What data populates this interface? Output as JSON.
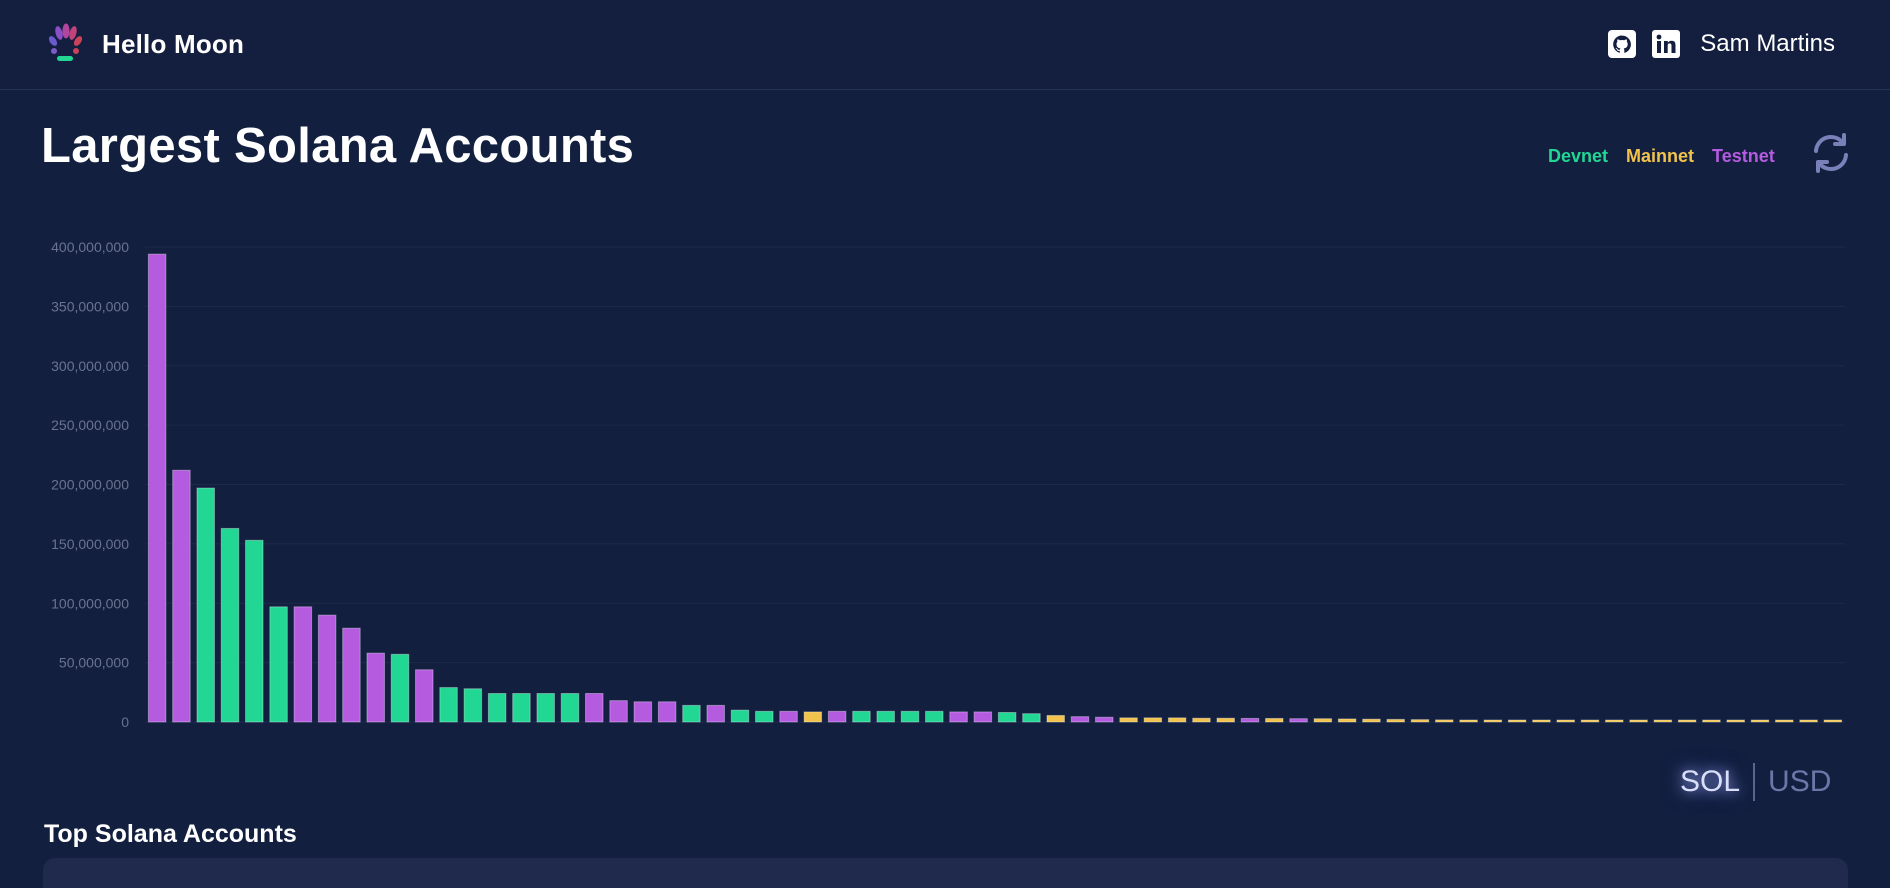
{
  "brand": {
    "name": "Hello Moon"
  },
  "nav": {
    "user": "Sam Martins",
    "icons": [
      "github-icon",
      "linkedin-icon"
    ]
  },
  "page": {
    "title": "Largest Solana Accounts"
  },
  "legend": [
    {
      "label": "Devnet",
      "color": "#22d694"
    },
    {
      "label": "Mainnet",
      "color": "#f2c34c"
    },
    {
      "label": "Testnet",
      "color": "#b55be0"
    }
  ],
  "toggle": {
    "sol": "SOL",
    "usd": "USD",
    "selected": "SOL"
  },
  "section": {
    "title": "Top Solana Accounts"
  },
  "colors": {
    "background": "#121f3f",
    "card": "#1f2a4c",
    "devnet": "#22d694",
    "mainnet": "#f2c34c",
    "testnet": "#b55be0"
  },
  "chart_data": {
    "type": "bar",
    "title": "",
    "xlabel": "",
    "ylabel": "",
    "ylim": [
      0,
      400000000
    ],
    "yticks": [
      0,
      50000000,
      100000000,
      150000000,
      200000000,
      250000000,
      300000000,
      350000000,
      400000000
    ],
    "ytick_labels": [
      "0",
      "50,000,000",
      "100,000,000",
      "150,000,000",
      "200,000,000",
      "250,000,000",
      "300,000,000",
      "350,000,000",
      "400,000,000"
    ],
    "grid": true,
    "legend": "top-right",
    "values": [
      394000000,
      212000000,
      197000000,
      163000000,
      153000000,
      97000000,
      97000000,
      90000000,
      79000000,
      58000000,
      57000000,
      44000000,
      29000000,
      28000000,
      24000000,
      24000000,
      24000000,
      24000000,
      24000000,
      18000000,
      17000000,
      17000000,
      14000000,
      14000000,
      10000000,
      9000000,
      9000000,
      8500000,
      9000000,
      9000000,
      9000000,
      9000000,
      9000000,
      8500000,
      8500000,
      8000000,
      7000000,
      5500000,
      4500000,
      4000000,
      3500000,
      3500000,
      3500000,
      3200000,
      3200000,
      3000000,
      3000000,
      2800000,
      2800000,
      2600000,
      2400000,
      2200000,
      2000000,
      1800000,
      1600000,
      1500000,
      1400000,
      1300000,
      1200000,
      1100000,
      1000000,
      900000,
      800000,
      700000,
      600000,
      500000,
      400000,
      300000,
      200000,
      100000
    ],
    "networks": [
      "Testnet",
      "Testnet",
      "Devnet",
      "Devnet",
      "Devnet",
      "Devnet",
      "Testnet",
      "Testnet",
      "Testnet",
      "Testnet",
      "Devnet",
      "Testnet",
      "Devnet",
      "Devnet",
      "Devnet",
      "Devnet",
      "Devnet",
      "Devnet",
      "Testnet",
      "Testnet",
      "Testnet",
      "Testnet",
      "Devnet",
      "Testnet",
      "Devnet",
      "Devnet",
      "Testnet",
      "Mainnet",
      "Testnet",
      "Devnet",
      "Devnet",
      "Devnet",
      "Devnet",
      "Testnet",
      "Testnet",
      "Devnet",
      "Devnet",
      "Mainnet",
      "Testnet",
      "Testnet",
      "Mainnet",
      "Mainnet",
      "Mainnet",
      "Mainnet",
      "Mainnet",
      "Testnet",
      "Mainnet",
      "Testnet",
      "Mainnet",
      "Mainnet",
      "Mainnet",
      "Mainnet",
      "Mainnet",
      "Mainnet",
      "Mainnet",
      "Mainnet",
      "Mainnet",
      "Mainnet",
      "Mainnet",
      "Mainnet",
      "Mainnet",
      "Mainnet",
      "Mainnet",
      "Mainnet",
      "Mainnet",
      "Mainnet",
      "Mainnet",
      "Mainnet",
      "Mainnet",
      "Mainnet"
    ]
  }
}
